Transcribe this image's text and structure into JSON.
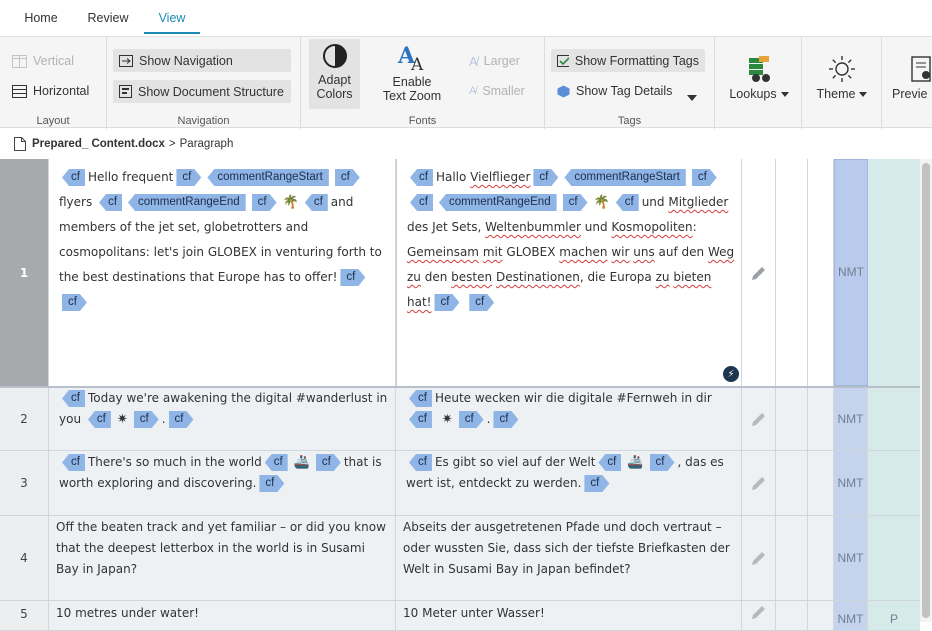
{
  "tabs": [
    {
      "label": "Home"
    },
    {
      "label": "Review"
    },
    {
      "label": "View",
      "active": true
    }
  ],
  "ribbon": {
    "layout": {
      "label": "Layout",
      "vertical": "Vertical",
      "horizontal": "Horizontal"
    },
    "navigation": {
      "label": "Navigation",
      "show_navigation": "Show Navigation",
      "show_document_structure": "Show Document Structure"
    },
    "fonts": {
      "label": "Fonts",
      "adapt_colors_line1": "Adapt",
      "adapt_colors_line2": "Colors",
      "enable_text_zoom_line1": "Enable",
      "enable_text_zoom_line2": "Text Zoom",
      "larger": "Larger",
      "smaller": "Smaller"
    },
    "tags": {
      "label": "Tags",
      "show_formatting_tags": "Show Formatting Tags",
      "show_tag_details": "Show Tag Details"
    },
    "lookups": "Lookups",
    "theme": "Theme",
    "preview": "Previe"
  },
  "breadcrumb": {
    "file": "Prepared_ Content.docx",
    "separator": ">",
    "node": "Paragraph"
  },
  "tag_label": "cf",
  "comment_start": "commentRangeStart",
  "comment_end": "commentRangeEnd",
  "segments": [
    {
      "num": "1",
      "origin": "NMT",
      "status": "",
      "source": {
        "t1": "Hello frequent",
        "t2": "flyers",
        "t3": "and members of the jet set, globetrotters and cosmopolitans: let's join GLOBEX in venturing forth to the best destinations that Europe has to offer!"
      },
      "target": {
        "t1": "Hallo",
        "t1b": "Vielflieger",
        "t2": "und",
        "t2b": "Mitglieder",
        "t3a": "des Jet Sets,",
        "t3b": "Weltenbummler",
        "t3c": "und",
        "t3d": "Kosmopoliten",
        "t3e": ":",
        "t4a": "Gemeinsam",
        "t4b": "mit",
        "t4c": "GLOBEX",
        "t4d": "machen",
        "t4e": "wir",
        "t4f": "uns",
        "t4g": "auf den",
        "t4h": "Weg",
        "t4i": "zu",
        "t5a": "den",
        "t5b": "besten",
        "t5c": "Destinationen",
        "t5d": ", die Europa",
        "t5e": "zu",
        "t5f": "bieten",
        "t5g": "hat!"
      }
    },
    {
      "num": "2",
      "origin": "NMT",
      "status": "",
      "source": {
        "t1": "Today we're awakening the digital #wanderlust in you",
        "dot": "."
      },
      "target": {
        "t1": "Heute wecken wir die digitale #Fernweh in dir",
        "dot": "."
      }
    },
    {
      "num": "3",
      "origin": "NMT",
      "status": "",
      "source": {
        "t1": "There's so much in the world",
        "t2": "that is worth exploring and discovering."
      },
      "target": {
        "t1": "Es gibt so viel auf der Welt",
        "t2": ", das es wert ist, entdeckt zu werden."
      }
    },
    {
      "num": "4",
      "origin": "NMT",
      "status": "",
      "source": {
        "t1": "Off the beaten track and yet familiar – or did you know that the deepest letterbox in the world is in Susami Bay in Japan?"
      },
      "target": {
        "t1": "Abseits der ausgetretenen Pfade und doch vertraut – oder wussten Sie, dass sich der tiefste Briefkasten der Welt in Susami Bay in Japan befindet?"
      }
    },
    {
      "num": "5",
      "origin": "NMT",
      "status": "P",
      "source": {
        "t1": "10 metres under water!"
      },
      "target": {
        "t1": "10 Meter unter Wasser!"
      }
    }
  ],
  "colors": {
    "accent": "#1a8bb5",
    "tag": "#8fb5e6",
    "origin_col": "#c5d4ec",
    "status_col": "#d6eaea"
  },
  "icons": [
    "layout-vertical-icon",
    "layout-horizontal-icon",
    "navigation-icon",
    "document-structure-icon",
    "contrast-icon",
    "text-zoom-icon",
    "font-larger-icon",
    "font-smaller-icon",
    "formatting-tags-icon",
    "tag-details-icon",
    "lookups-icon",
    "theme-sun-icon",
    "preview-icon",
    "document-icon",
    "edit-pencil-icon",
    "qa-icon"
  ]
}
